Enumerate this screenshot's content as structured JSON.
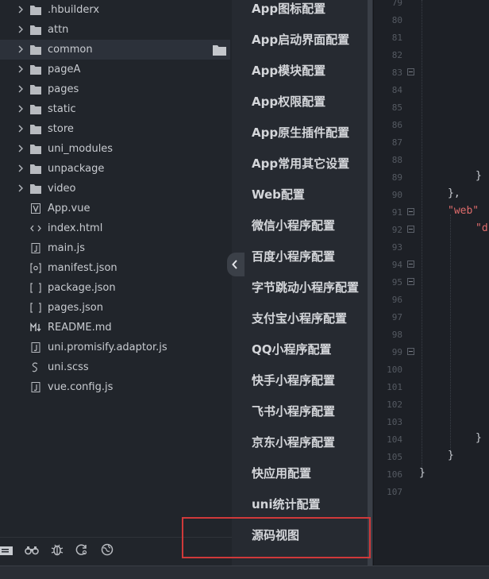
{
  "explorer": {
    "items": [
      {
        "label": ".hbuilderx",
        "type": "folder",
        "expandable": true
      },
      {
        "label": "attn",
        "type": "folder",
        "expandable": true
      },
      {
        "label": "common",
        "type": "folder",
        "expandable": true,
        "selected": true
      },
      {
        "label": "pageA",
        "type": "folder",
        "expandable": true
      },
      {
        "label": "pages",
        "type": "folder",
        "expandable": true
      },
      {
        "label": "static",
        "type": "folder",
        "expandable": true
      },
      {
        "label": "store",
        "type": "folder",
        "expandable": true
      },
      {
        "label": "uni_modules",
        "type": "folder",
        "expandable": true
      },
      {
        "label": "unpackage",
        "type": "folder",
        "expandable": true
      },
      {
        "label": "video",
        "type": "folder",
        "expandable": true
      },
      {
        "label": "App.vue",
        "type": "vue-file-icon"
      },
      {
        "label": "index.html",
        "type": "html-file-icon"
      },
      {
        "label": "main.js",
        "type": "js-file-icon"
      },
      {
        "label": "manifest.json",
        "type": "manifest-file-icon"
      },
      {
        "label": "package.json",
        "type": "json-file-icon"
      },
      {
        "label": "pages.json",
        "type": "json-file-icon"
      },
      {
        "label": "README.md",
        "type": "markdown-file-icon"
      },
      {
        "label": "uni.promisify.adaptor.js",
        "type": "js-file-icon"
      },
      {
        "label": "uni.scss",
        "type": "scss-file-icon"
      },
      {
        "label": "vue.config.js",
        "type": "js-file-icon"
      }
    ],
    "toolbar_icons": [
      "files-icon",
      "binoculars-icon",
      "bug-icon",
      "refresh-search-icon",
      "globe-icon"
    ]
  },
  "config_menu": {
    "items": [
      "App图标配置",
      "App启动界面配置",
      "App模块配置",
      "App权限配置",
      "App原生插件配置",
      "App常用其它设置",
      "Web配置",
      "微信小程序配置",
      "百度小程序配置",
      "字节跳动小程序配置",
      "支付宝小程序配置",
      "QQ小程序配置",
      "快手小程序配置",
      "飞书小程序配置",
      "京东小程序配置",
      "快应用配置",
      "uni统计配置",
      "源码视图"
    ],
    "highlighted_item": "源码视图",
    "highlight_color": "#d0393a"
  },
  "editor": {
    "line_numbers": [
      "79",
      "80",
      "81",
      "82",
      "83",
      "84",
      "85",
      "86",
      "87",
      "88",
      "89",
      "90",
      "91",
      "92",
      "93",
      "94",
      "95",
      "96",
      "97",
      "98",
      "99",
      "100",
      "101",
      "102",
      "103",
      "104",
      "105",
      "106",
      "107"
    ],
    "folded_lines": [
      "83",
      "91",
      "92",
      "94",
      "95",
      "99"
    ],
    "code_lines": {
      "line89": "}",
      "line90": "},",
      "line91": "\"web\"",
      "line92": "\"d",
      "line104": "}",
      "line105": "}",
      "line106": "}"
    },
    "string_color": "#e06c6c"
  }
}
